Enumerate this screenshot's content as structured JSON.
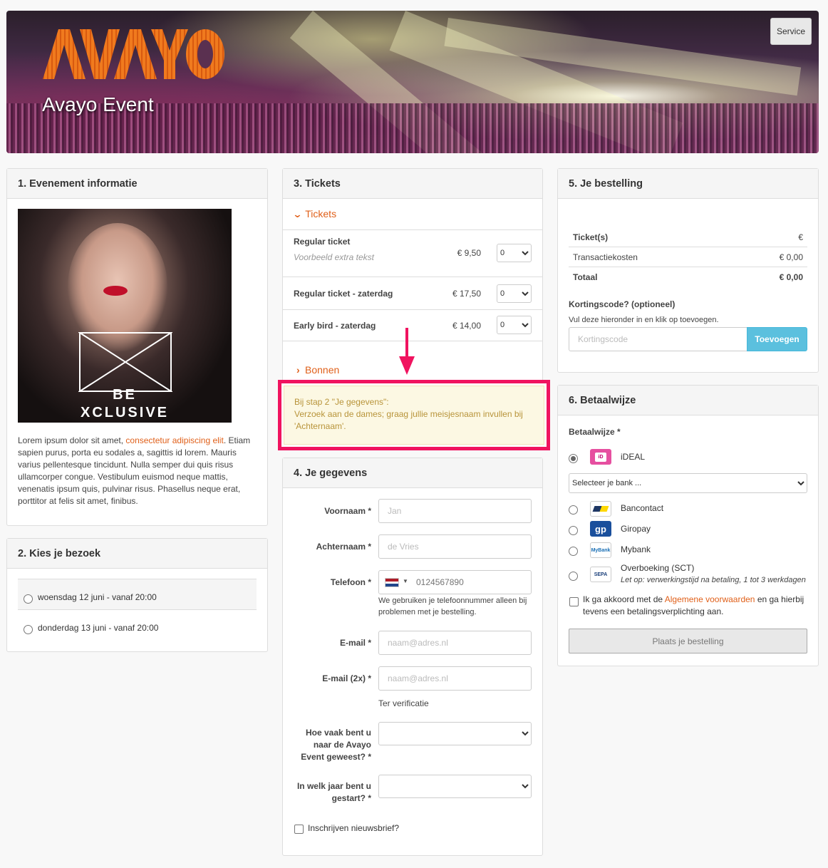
{
  "header": {
    "logo_text": "AVAYO",
    "event_title": "Avayo Event",
    "service_label": "Service"
  },
  "event_info": {
    "heading": "1. Evenement informatie",
    "image_text_line1": "BE",
    "image_text_line2": "XCLUSIVE",
    "desc_before_link": "Lorem ipsum dolor sit amet, ",
    "desc_link": "consectetur adipiscing elit",
    "desc_after_link": ". Etiam sapien purus, porta eu sodales a, sagittis id lorem. Mauris varius pellentesque tincidunt. Nulla semper dui quis risus ullamcorper congue. Vestibulum euismod neque mattis, venenatis ipsum quis, pulvinar risus. Phasellus neque erat, porttitor at felis sit amet, finibus."
  },
  "visit": {
    "heading": "2. Kies je bezoek",
    "options": [
      "woensdag 12 juni - vanaf 20:00",
      "donderdag 13 juni - vanaf 20:00"
    ]
  },
  "tickets": {
    "heading": "3. Tickets",
    "section_label": "Tickets",
    "items": [
      {
        "name": "Regular ticket",
        "extra": "Voorbeeld extra tekst",
        "price": "€ 9,50",
        "qty": "0"
      },
      {
        "name": "Regular ticket - zaterdag",
        "price": "€ 17,50",
        "qty": "0"
      },
      {
        "name": "Early bird - zaterdag",
        "price": "€ 14,00",
        "qty": "0"
      }
    ],
    "vouchers_label": "Bonnen"
  },
  "notice": {
    "line1": "Bij stap 2 \"Je gegevens\":",
    "line2": "Verzoek aan de dames; graag jullie meisjesnaam invullen bij 'Achternaam'.",
    "highlight_color": "#f0135f"
  },
  "details": {
    "heading": "4. Je gegevens",
    "first_name_label": "Voornaam *",
    "first_name_placeholder": "Jan",
    "last_name_label": "Achternaam *",
    "last_name_placeholder": "de Vries",
    "phone_label": "Telefoon *",
    "phone_placeholder": "0124567890",
    "phone_help": "We gebruiken je telefoonnummer alleen bij problemen met je bestelling.",
    "email_label": "E-mail *",
    "email_placeholder": "naam@adres.nl",
    "email2_label": "E-mail (2x) *",
    "email2_placeholder": "naam@adres.nl",
    "email2_help": "Ter verificatie",
    "q1_label": "Hoe vaak bent u naar de Avayo Event geweest? *",
    "q2_label": "In welk jaar bent u gestart? *",
    "newsletter_label": "Inschrijven nieuwsbrief?"
  },
  "order": {
    "heading": "5. Je bestelling",
    "rows": [
      {
        "label": "Ticket(s)",
        "value": "€"
      },
      {
        "label": "Transactiekosten",
        "value": "€ 0,00"
      },
      {
        "label": "Totaal",
        "value": "€ 0,00"
      }
    ],
    "discount_label": "Kortingscode? (optioneel)",
    "discount_help": "Vul deze hieronder in en klik op toevoegen.",
    "discount_placeholder": "Kortingscode",
    "add_button": "Toevoegen"
  },
  "payment": {
    "heading": "6. Betaalwijze",
    "label": "Betaalwijze *",
    "methods": [
      {
        "name": "iDEAL",
        "icon": "ideal-icon"
      },
      {
        "name": "Bancontact",
        "icon": "bancontact-icon"
      },
      {
        "name": "Giropay",
        "icon": "giropay-icon"
      },
      {
        "name": "Mybank",
        "icon": "mybank-icon"
      },
      {
        "name": "Overboeking (SCT)",
        "note": "Let op: verwerkingstijd na betaling, 1 tot 3 werkdagen",
        "icon": "sepa-icon"
      }
    ],
    "bank_select": "Selecteer je bank ...",
    "terms_before": "Ik ga akkoord met de ",
    "terms_link": "Algemene voorwaarden",
    "terms_after": " en ga hierbij tevens een betalingsverplichting aan.",
    "submit_button": "Plaats je bestelling"
  },
  "colors": {
    "accent": "#e0601a",
    "button_blue": "#5bc0de"
  }
}
